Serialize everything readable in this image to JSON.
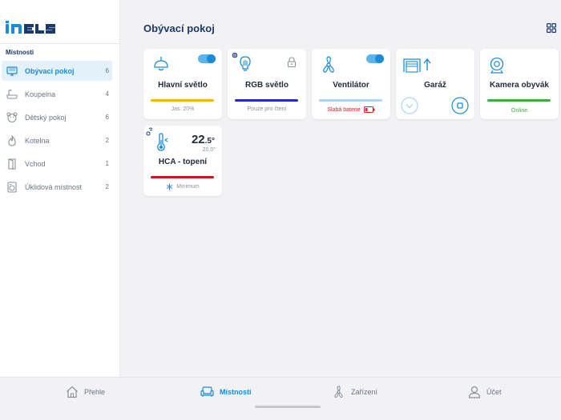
{
  "app": {
    "logo_text": "iNELS"
  },
  "sidebar": {
    "section_title": "Místnosti",
    "items": [
      {
        "label": "Obývací pokoj",
        "count": "6",
        "icon": "monitor-icon",
        "active": true
      },
      {
        "label": "Koupelna",
        "count": "4",
        "icon": "bathtub-icon",
        "active": false
      },
      {
        "label": "Dětský pokoj",
        "count": "6",
        "icon": "teddy-bear-icon",
        "active": false
      },
      {
        "label": "Kotelna",
        "count": "2",
        "icon": "flame-icon",
        "active": false
      },
      {
        "label": "Vchod",
        "count": "1",
        "icon": "door-icon",
        "active": false
      },
      {
        "label": "Úklidová místnost",
        "count": "2",
        "icon": "washer-icon",
        "active": false
      }
    ]
  },
  "main": {
    "title": "Obývací pokoj",
    "cards": [
      {
        "title": "Hlavní světlo",
        "status": "Jas: 20%",
        "bar_color": "#f5b800",
        "toggle_on": true,
        "icon": "ceiling-lamp-icon"
      },
      {
        "title": "RGB světlo",
        "status": "Pouze pro čtení",
        "bar_color": "#1f2ad6",
        "locked": true,
        "icon": "rgb-bulb-icon"
      },
      {
        "title": "Ventilátor",
        "status": "Slabá baterie",
        "status_color": "#e02020",
        "bar_color": "#a9d6f5",
        "toggle_on": true,
        "icon": "fan-icon"
      },
      {
        "title": "Garáž",
        "icon": "garage-icon"
      },
      {
        "title": "Kamera obyvák",
        "status": "Online",
        "status_color": "#3fae3f",
        "bar_color": "#3fae3f",
        "icon": "camera-icon"
      },
      {
        "title": "HCA - topení",
        "temperature_main": "22",
        "temperature_decimal": ".5°",
        "temperature_set": "20.0°",
        "status": "Minimum",
        "bar_color": "#d01818",
        "icon": "thermometer-icon"
      }
    ]
  },
  "bottom_nav": [
    {
      "label": "Přehle",
      "icon": "home-icon",
      "active": false
    },
    {
      "label": "Místnosti",
      "icon": "sofa-icon",
      "active": true
    },
    {
      "label": "Zařízení",
      "icon": "fan-icon",
      "active": false
    },
    {
      "label": "Účet",
      "icon": "user-icon",
      "active": false
    }
  ],
  "colors": {
    "accent": "#1a8bd6",
    "title": "#1a3a6c",
    "active_bg": "#e3f1fb"
  }
}
